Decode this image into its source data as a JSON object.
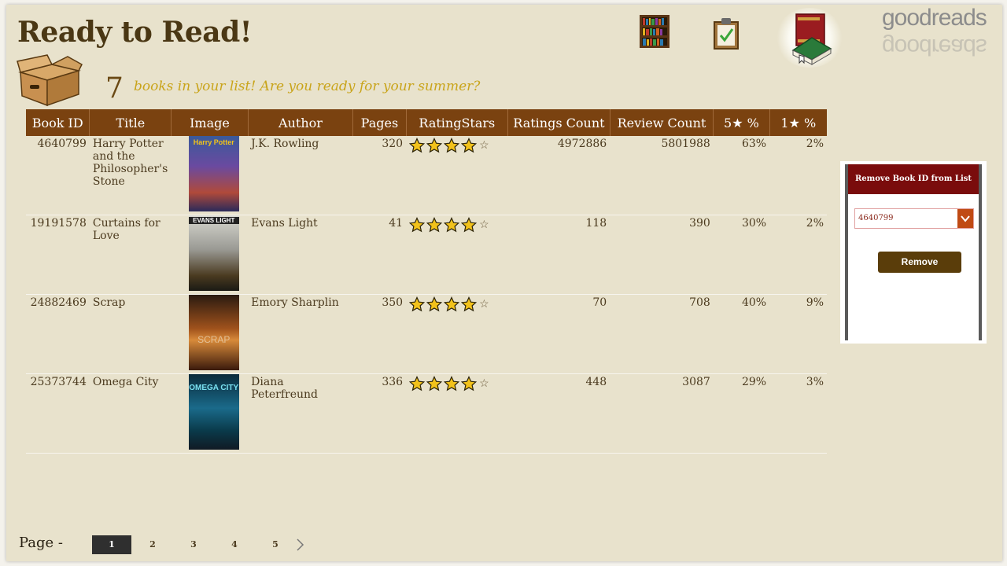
{
  "header": {
    "title": "Ready to Read!",
    "logo_text": "goodreads"
  },
  "summary": {
    "count": "7",
    "tagline": "books in your list! Are you ready for your summer?"
  },
  "table": {
    "columns": [
      "Book ID",
      "Title",
      "Image",
      "Author",
      "Pages",
      "RatingStars",
      "Ratings Count",
      "Review Count",
      "5★ %",
      "1★ %"
    ],
    "rows": [
      {
        "book_id": "4640799",
        "title": "Harry Potter and the Philosopher's Stone",
        "cover_text": "Harry Potter",
        "author": "J.K. Rowling",
        "pages": "320",
        "stars": 4,
        "ratings_count": "4972886",
        "review_count": "5801988",
        "five_pct": "63%",
        "one_pct": "2%"
      },
      {
        "book_id": "19191578",
        "title": "Curtains for Love",
        "cover_text": "EVANS LIGHT",
        "author": "Evans Light",
        "pages": "41",
        "stars": 4,
        "ratings_count": "118",
        "review_count": "390",
        "five_pct": "30%",
        "one_pct": "2%"
      },
      {
        "book_id": "24882469",
        "title": "Scrap",
        "cover_text": "SCRAP",
        "author": "Emory Sharplin",
        "pages": "350",
        "stars": 4,
        "ratings_count": "70",
        "review_count": "708",
        "five_pct": "40%",
        "one_pct": "9%"
      },
      {
        "book_id": "25373744",
        "title": "Omega City",
        "cover_text": "OMEGA CITY",
        "author": "Diana Peterfreund",
        "pages": "336",
        "stars": 4,
        "ratings_count": "448",
        "review_count": "3087",
        "five_pct": "29%",
        "one_pct": "3%"
      }
    ]
  },
  "remove_panel": {
    "title": "Remove Book ID from List",
    "selected_id": "4640799",
    "button_label": "Remove"
  },
  "pagination": {
    "label": "Page  -",
    "pages": [
      "1",
      "2",
      "3",
      "4",
      "5"
    ],
    "current": "1"
  },
  "colors": {
    "header_bg": "#7a4210",
    "page_bg": "#e8e2cc",
    "title": "#4a3714",
    "tagline": "#c9a41a",
    "panel_header": "#7a0c0c",
    "button": "#5a3d0a",
    "star": "#f2c21b"
  },
  "icons": {
    "nav": [
      "bookshelf-icon",
      "clipboard-check-icon",
      "books-icon"
    ],
    "box": "cardboard-box-icon",
    "dropdown": "chevron-down-icon",
    "next": "chevron-right-icon"
  }
}
